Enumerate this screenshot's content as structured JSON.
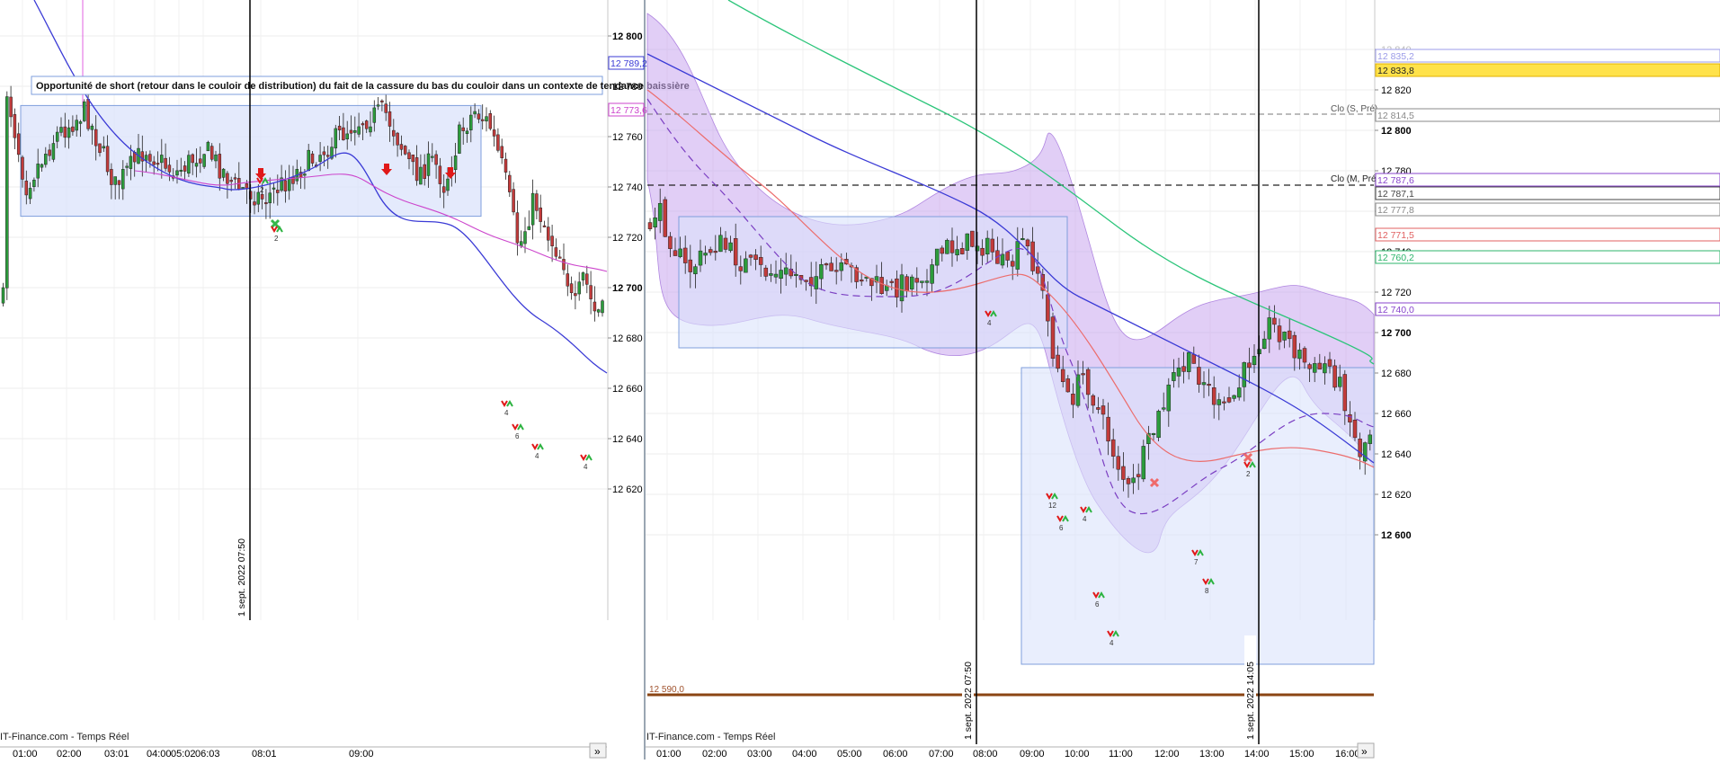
{
  "charts": [
    {
      "footer": "IT-Finance.com - Temps Réel",
      "annotation": "Opportunité de short (retour dans le couloir de distribution) du fait de la cassure du bas du couloir dans un contexte de tendance baissière",
      "vline_labels": [
        "1 sept. 2022 07:50"
      ],
      "time_ticks": [
        "01:00",
        "02:00",
        "03:01",
        "04:00",
        "05:02",
        "06:03",
        "08:01",
        "09:00"
      ],
      "price_ticks": [
        "12 800",
        "12 780",
        "12 760",
        "12 740",
        "12 720",
        "12 700",
        "12 680",
        "12 660",
        "12 640",
        "12 620"
      ],
      "price_tags": [
        {
          "text": "12 789,2",
          "color": "#3b3bd6"
        },
        {
          "text": "12 773,6",
          "color": "#cc44cc"
        }
      ],
      "signal_counts": [
        "2",
        "2",
        "4",
        "6",
        "4",
        "4"
      ],
      "scroll_glyph": "»"
    },
    {
      "footer": "IT-Finance.com - Temps Réel",
      "price_level_label": "12 590,0",
      "vline_labels": [
        "1 sept. 2022 07:50",
        "1 sept. 2022 14:05"
      ],
      "time_ticks": [
        "01:00",
        "02:00",
        "03:00",
        "04:00",
        "05:00",
        "06:00",
        "07:00",
        "08:00",
        "09:00",
        "10:00",
        "11:00",
        "12:00",
        "13:00",
        "14:00",
        "15:00",
        "16:00"
      ],
      "price_ticks": [
        "12 840",
        "12 820",
        "12 800",
        "12 780",
        "12 760",
        "12 740",
        "12 720",
        "12 700",
        "12 680",
        "12 660",
        "12 640",
        "12 620",
        "12 600"
      ],
      "price_tags": [
        {
          "text": "12 835,2",
          "color": "#9b9be8"
        },
        {
          "text": "12 833,8",
          "color": "#e8a800"
        },
        {
          "text": "12 814,5",
          "color": "#888888"
        },
        {
          "text": "12 787,6",
          "color": "#8844cc"
        },
        {
          "text": "12 787,1",
          "color": "#444444"
        },
        {
          "text": "12 777,8",
          "color": "#888888"
        },
        {
          "text": "12 771,5",
          "color": "#e06060"
        },
        {
          "text": "12 760,2",
          "color": "#2cb56b"
        },
        {
          "text": "12 740,0",
          "color": "#8844cc"
        }
      ],
      "reference_lines": [
        "Clo (S, Pré)",
        "Clo (M, Pré)"
      ],
      "signal_counts": [
        "4",
        "12",
        "6",
        "4",
        "6",
        "4",
        "7",
        "8",
        "2"
      ],
      "scroll_glyph": "»"
    }
  ],
  "chart_data": [
    {
      "type": "candlestick",
      "x_unit": "time",
      "y_unit": "price",
      "ylim": [
        12615,
        12810
      ],
      "xlim": [
        "00:40",
        "10:40"
      ],
      "event_time": "07:50",
      "distribution_box": {
        "x_range": [
          "00:45",
          "05:50"
        ],
        "y_range": [
          12728,
          12772
        ]
      },
      "candles_close_path": [
        [
          "00:40",
          12780
        ],
        [
          "01:00",
          12740
        ],
        [
          "01:30",
          12760
        ],
        [
          "02:00",
          12770
        ],
        [
          "02:30",
          12740
        ],
        [
          "03:00",
          12755
        ],
        [
          "03:30",
          12745
        ],
        [
          "04:00",
          12755
        ],
        [
          "04:30",
          12740
        ],
        [
          "05:00",
          12735
        ],
        [
          "05:30",
          12745
        ],
        [
          "06:00",
          12755
        ],
        [
          "06:30",
          12765
        ],
        [
          "07:00",
          12770
        ],
        [
          "07:30",
          12745
        ],
        [
          "07:50",
          12750
        ],
        [
          "08:00",
          12740
        ],
        [
          "08:15",
          12760
        ],
        [
          "08:30",
          12770
        ],
        [
          "08:45",
          12765
        ],
        [
          "09:00",
          12745
        ],
        [
          "09:15",
          12715
        ],
        [
          "09:30",
          12735
        ],
        [
          "09:45",
          12720
        ],
        [
          "10:00",
          12710
        ],
        [
          "10:10",
          12690
        ],
        [
          "10:20",
          12705
        ],
        [
          "10:30",
          12690
        ],
        [
          "10:40",
          12690
        ],
        [
          "11:00",
          12680
        ],
        [
          "11:20",
          12670
        ],
        [
          "11:40",
          12685
        ],
        [
          "12:00",
          12700
        ],
        [
          "12:20",
          12675
        ],
        [
          "12:40",
          12665
        ],
        [
          "13:00",
          12680
        ],
        [
          "13:20",
          12695
        ]
      ],
      "series": [
        {
          "name": "",
          "color": "#3b3bd6",
          "values": [
            [
              "01:30",
              12790
            ],
            [
              "03:00",
              12760
            ],
            [
              "05:00",
              12748
            ],
            [
              "07:00",
              12752
            ],
            [
              "08:30",
              12755
            ],
            [
              "10:00",
              12735
            ],
            [
              "11:30",
              12712
            ],
            [
              "13:20",
              12688
            ]
          ]
        },
        {
          "name": "",
          "color": "#cc44cc",
          "values": [
            [
              "03:00",
              12748
            ],
            [
              "05:00",
              12746
            ],
            [
              "07:00",
              12750
            ],
            [
              "08:30",
              12748
            ],
            [
              "10:00",
              12740
            ],
            [
              "11:30",
              12732
            ],
            [
              "13:20",
              12720
            ]
          ]
        }
      ]
    },
    {
      "type": "candlestick",
      "x_unit": "time",
      "y_unit": "price",
      "ylim": [
        12595,
        12848
      ],
      "xlim": [
        "00:30",
        "16:20"
      ],
      "event_times": [
        "07:50",
        "14:05"
      ],
      "horizontal_levels": [
        12814.5,
        12787.1,
        12590.0
      ],
      "distribution_boxes": [
        {
          "x_range": [
            "01:10",
            "09:40"
          ],
          "y_range": [
            12716,
            12751
          ]
        },
        {
          "x_range": [
            "08:30",
            "16:20"
          ],
          "y_range": [
            12604,
            12716
          ]
        }
      ],
      "candles_close_path": [
        [
          "00:30",
          12752
        ],
        [
          "00:40",
          12762
        ],
        [
          "01:00",
          12745
        ],
        [
          "01:20",
          12730
        ],
        [
          "02:00",
          12745
        ],
        [
          "02:30",
          12735
        ],
        [
          "03:00",
          12730
        ],
        [
          "04:00",
          12728
        ],
        [
          "05:00",
          12730
        ],
        [
          "05:40",
          12720
        ],
        [
          "06:00",
          12724
        ],
        [
          "06:40",
          12732
        ],
        [
          "07:00",
          12742
        ],
        [
          "07:40",
          12745
        ],
        [
          "08:00",
          12740
        ],
        [
          "08:20",
          12730
        ],
        [
          "08:40",
          12745
        ],
        [
          "09:00",
          12730
        ],
        [
          "09:20",
          12690
        ],
        [
          "09:40",
          12665
        ],
        [
          "10:00",
          12680
        ],
        [
          "10:20",
          12660
        ],
        [
          "10:40",
          12640
        ],
        [
          "11:00",
          12620
        ],
        [
          "11:20",
          12640
        ],
        [
          "11:40",
          12660
        ],
        [
          "12:00",
          12680
        ],
        [
          "12:20",
          12685
        ],
        [
          "12:40",
          12675
        ],
        [
          "13:00",
          12660
        ],
        [
          "13:20",
          12670
        ],
        [
          "13:40",
          12690
        ],
        [
          "14:00",
          12705
        ],
        [
          "14:20",
          12700
        ],
        [
          "14:40",
          12690
        ],
        [
          "15:00",
          12680
        ],
        [
          "15:20",
          12685
        ],
        [
          "15:40",
          12670
        ],
        [
          "16:00",
          12640
        ],
        [
          "16:20",
          12655
        ]
      ],
      "series": [
        {
          "name": "",
          "color": "#3b3bd6",
          "values": [
            [
              "00:30",
              12800
            ],
            [
              "03:00",
              12785
            ],
            [
              "06:00",
              12770
            ],
            [
              "08:00",
              12760
            ],
            [
              "10:00",
              12745
            ],
            [
              "12:00",
              12720
            ],
            [
              "14:00",
              12705
            ],
            [
              "16:20",
              12685
            ]
          ]
        },
        {
          "name": "",
          "color": "#2cb56b",
          "values": [
            [
              "03:00",
              12848
            ],
            [
              "06:00",
              12825
            ],
            [
              "08:00",
              12810
            ],
            [
              "10:00",
              12785
            ],
            [
              "12:00",
              12765
            ],
            [
              "14:00",
              12745
            ],
            [
              "16:20",
              12720
            ]
          ]
        },
        {
          "name": "",
          "color": "#e06060",
          "values": [
            [
              "00:30",
              12785
            ],
            [
              "02:00",
              12770
            ],
            [
              "04:00",
              12745
            ],
            [
              "06:00",
              12738
            ],
            [
              "08:00",
              12742
            ],
            [
              "09:30",
              12738
            ],
            [
              "10:30",
              12700
            ],
            [
              "12:00",
              12670
            ],
            [
              "14:00",
              12680
            ],
            [
              "16:20",
              12678
            ]
          ]
        }
      ]
    }
  ]
}
